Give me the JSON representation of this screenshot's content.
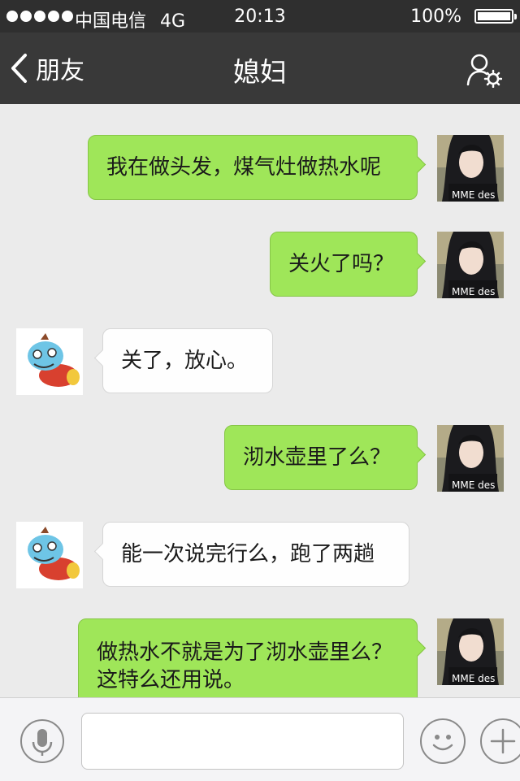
{
  "status_bar": {
    "carrier": "中国电信",
    "network": "4G",
    "time": "20:13",
    "battery": "100%"
  },
  "nav": {
    "back_label": "朋友",
    "title": "媳妇"
  },
  "messages": [
    {
      "side": "me",
      "text": "我在做头发，煤气灶做热水呢"
    },
    {
      "side": "me",
      "text": "关火了吗？"
    },
    {
      "side": "other",
      "text": "关了，放心。"
    },
    {
      "side": "me",
      "text": "沏水壶里了么？"
    },
    {
      "side": "other",
      "text": "能一次说完行么，跑了两趟"
    },
    {
      "side": "me",
      "text": "做热水不就是为了沏水壶里么？这特么还用说。"
    }
  ],
  "avatar_text": "MME des",
  "input": {
    "value": "",
    "placeholder": ""
  },
  "colors": {
    "bubble_me": "#9fe659",
    "bubble_other": "#fefefe",
    "nav_bg": "#393939",
    "status_bg": "#2f2f2f",
    "chat_bg": "#ebebeb"
  }
}
